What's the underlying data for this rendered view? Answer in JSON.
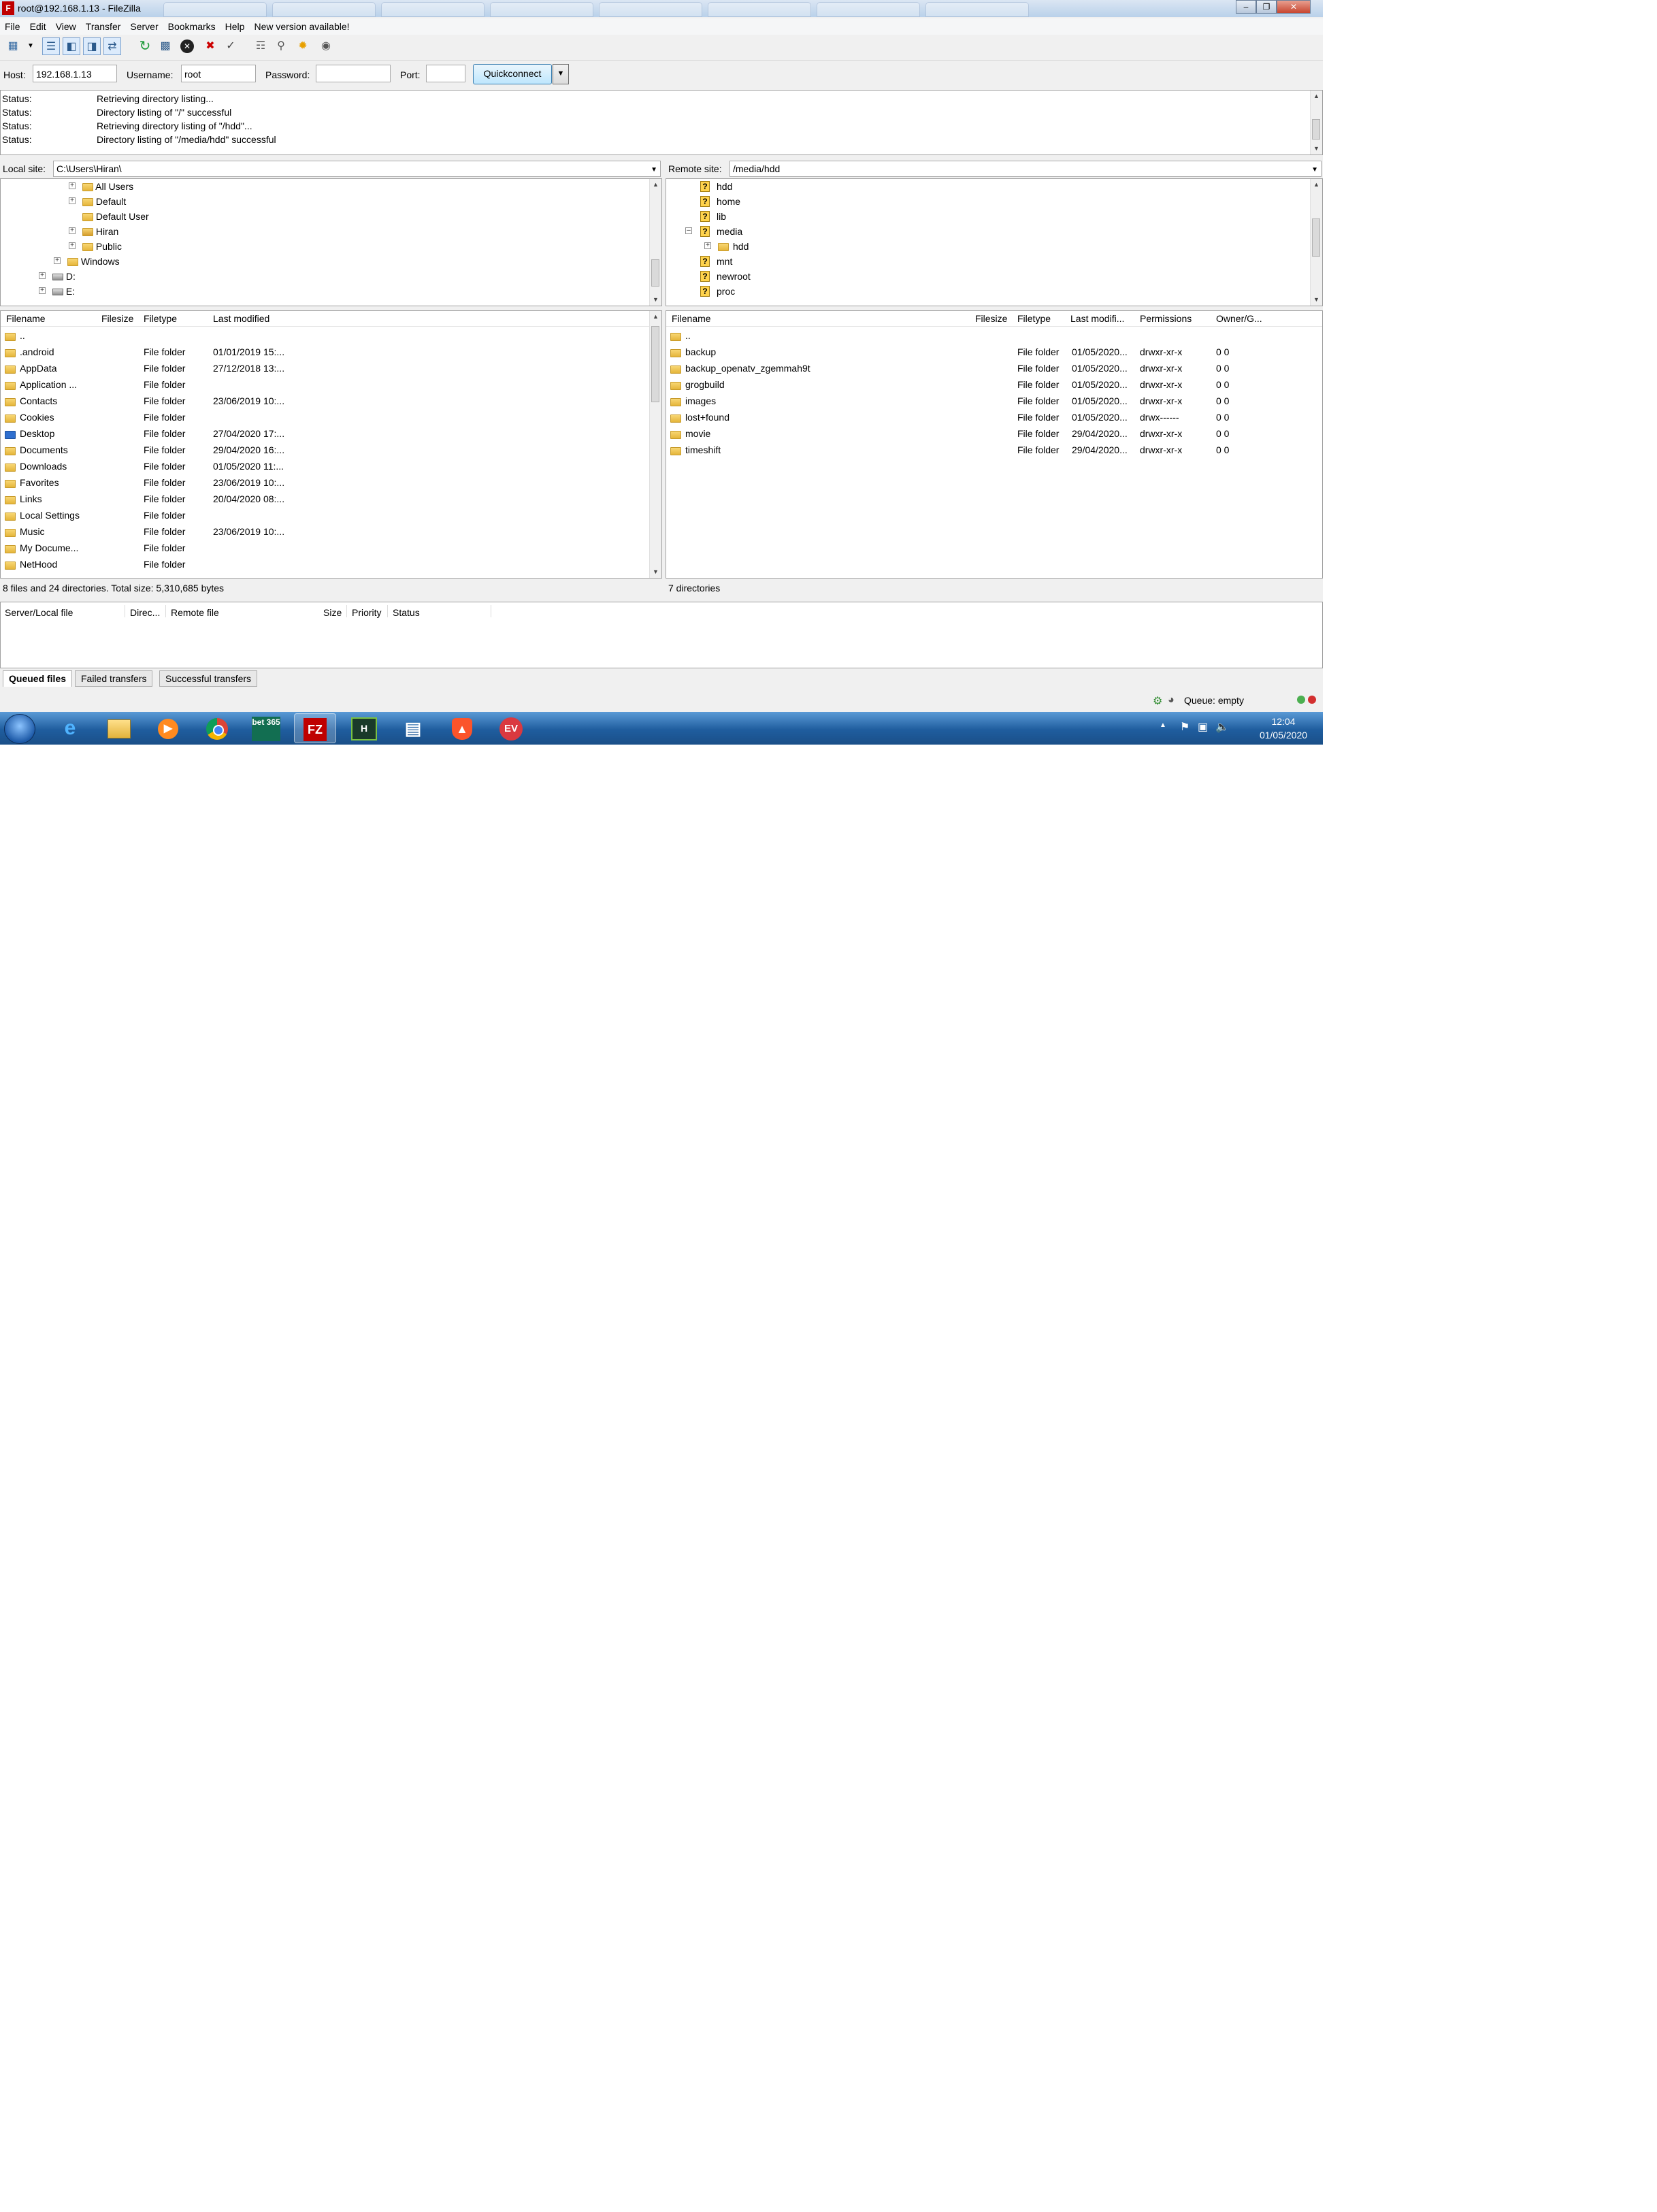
{
  "window": {
    "title": "root@192.168.1.13 - FileZilla",
    "app_icon": "filezilla-icon"
  },
  "menu": [
    "File",
    "Edit",
    "View",
    "Transfer",
    "Server",
    "Bookmarks",
    "Help",
    "New version available!"
  ],
  "quickconnect": {
    "host_label": "Host:",
    "host_value": "192.168.1.13",
    "username_label": "Username:",
    "username_value": "root",
    "password_label": "Password:",
    "password_value": "",
    "port_label": "Port:",
    "port_value": "",
    "button_label": "Quickconnect"
  },
  "log": [
    {
      "key": "Status:",
      "text": "Retrieving directory listing..."
    },
    {
      "key": "Status:",
      "text": "Directory listing of \"/\" successful"
    },
    {
      "key": "Status:",
      "text": "Retrieving directory listing of \"/hdd\"..."
    },
    {
      "key": "Status:",
      "text": "Directory listing of \"/media/hdd\" successful"
    }
  ],
  "local": {
    "label": "Local site:",
    "path": "C:\\Users\\Hiran\\",
    "tree": [
      "All Users",
      "Default",
      "Default User",
      "Hiran",
      "Public",
      "Windows",
      "D:",
      "E:"
    ],
    "columns": [
      "Filename",
      "Filesize",
      "Filetype",
      "Last modified"
    ],
    "files": [
      {
        "name": "..",
        "type": "",
        "modified": ""
      },
      {
        "name": ".android",
        "type": "File folder",
        "modified": "01/01/2019 15:..."
      },
      {
        "name": "AppData",
        "type": "File folder",
        "modified": "27/12/2018 13:..."
      },
      {
        "name": "Application ...",
        "type": "File folder",
        "modified": ""
      },
      {
        "name": "Contacts",
        "type": "File folder",
        "modified": "23/06/2019 10:..."
      },
      {
        "name": "Cookies",
        "type": "File folder",
        "modified": ""
      },
      {
        "name": "Desktop",
        "type": "File folder",
        "modified": "27/04/2020 17:..."
      },
      {
        "name": "Documents",
        "type": "File folder",
        "modified": "29/04/2020 16:..."
      },
      {
        "name": "Downloads",
        "type": "File folder",
        "modified": "01/05/2020 11:..."
      },
      {
        "name": "Favorites",
        "type": "File folder",
        "modified": "23/06/2019 10:..."
      },
      {
        "name": "Links",
        "type": "File folder",
        "modified": "20/04/2020 08:..."
      },
      {
        "name": "Local Settings",
        "type": "File folder",
        "modified": ""
      },
      {
        "name": "Music",
        "type": "File folder",
        "modified": "23/06/2019 10:..."
      },
      {
        "name": "My Docume...",
        "type": "File folder",
        "modified": ""
      },
      {
        "name": "NetHood",
        "type": "File folder",
        "modified": ""
      }
    ],
    "status": "8 files and 24 directories. Total size: 5,310,685 bytes"
  },
  "remote": {
    "label": "Remote site:",
    "path": "/media/hdd",
    "tree": [
      "hdd",
      "home",
      "lib",
      "media",
      "hdd",
      "mnt",
      "newroot",
      "proc"
    ],
    "columns": [
      "Filename",
      "Filesize",
      "Filetype",
      "Last modifi...",
      "Permissions",
      "Owner/G..."
    ],
    "files": [
      {
        "name": "..",
        "type": "",
        "modified": "",
        "perms": "",
        "owner": ""
      },
      {
        "name": "backup",
        "type": "File folder",
        "modified": "01/05/2020...",
        "perms": "drwxr-xr-x",
        "owner": "0 0"
      },
      {
        "name": "backup_openatv_zgemmah9t",
        "type": "File folder",
        "modified": "01/05/2020...",
        "perms": "drwxr-xr-x",
        "owner": "0 0"
      },
      {
        "name": "grogbuild",
        "type": "File folder",
        "modified": "01/05/2020...",
        "perms": "drwxr-xr-x",
        "owner": "0 0"
      },
      {
        "name": "images",
        "type": "File folder",
        "modified": "01/05/2020...",
        "perms": "drwxr-xr-x",
        "owner": "0 0"
      },
      {
        "name": "lost+found",
        "type": "File folder",
        "modified": "01/05/2020...",
        "perms": "drwx------",
        "owner": "0 0"
      },
      {
        "name": "movie",
        "type": "File folder",
        "modified": "29/04/2020...",
        "perms": "drwxr-xr-x",
        "owner": "0 0"
      },
      {
        "name": "timeshift",
        "type": "File folder",
        "modified": "29/04/2020...",
        "perms": "drwxr-xr-x",
        "owner": "0 0"
      }
    ],
    "status": "7 directories"
  },
  "queue": {
    "columns": [
      "Server/Local file",
      "Direc...",
      "Remote file",
      "Size",
      "Priority",
      "Status"
    ],
    "tabs": [
      "Queued files",
      "Failed transfers",
      "Successful transfers"
    ],
    "status": "Queue: empty"
  },
  "taskbar": {
    "apps": [
      "internet-explorer-icon",
      "file-explorer-icon",
      "media-player-icon",
      "chrome-icon",
      "bet365-icon",
      "filezilla-icon",
      "hdmi-app-icon",
      "network-tool-icon",
      "brave-icon",
      "expressvpn-icon"
    ],
    "bet365_label": "bet 365",
    "time": "12:04",
    "date": "01/05/2020"
  }
}
